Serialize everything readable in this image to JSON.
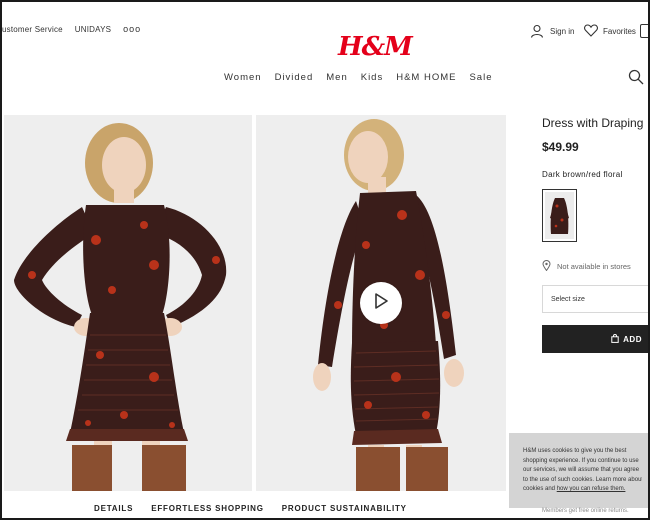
{
  "utility_bar": {
    "customer_service": "ustomer Service",
    "unidays": "UNIDAYS",
    "more": "ooo"
  },
  "brand": {
    "logo": "H&M",
    "color": "#e4001a"
  },
  "account": {
    "sign_in": "Sign in",
    "favorites": "Favorites"
  },
  "nav": {
    "items": [
      "Women",
      "Divided",
      "Men",
      "Kids",
      "H&M HOME",
      "Sale"
    ]
  },
  "product": {
    "title": "Dress with Draping",
    "price": "$49.99",
    "color_name": "Dark brown/red floral",
    "store_availability": "Not available in stores",
    "size_placeholder": "Select size",
    "add_button": "ADD"
  },
  "tabs": [
    "DETAILS",
    "EFFORTLESS SHOPPING",
    "PRODUCT SUSTAINABILITY"
  ],
  "cookie_banner": {
    "lines": [
      "H&M uses cookies to give you the best",
      "shopping experience. If you continue to use",
      "our services, we will assume that you agree",
      "to the use of such cookies. Learn more about"
    ],
    "last_line_prefix": "cookies and ",
    "last_line_link": "how you can refuse them."
  },
  "members_note": "Members get free online returns.",
  "colors": {
    "dress": "#3a1d1a",
    "floral": "#b8321a",
    "button": "#222222",
    "cookie_bg": "#d4d4d4"
  }
}
